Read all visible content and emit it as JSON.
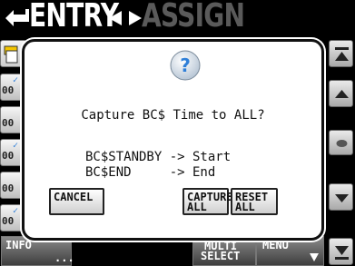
{
  "title": {
    "entry": "ENTRY",
    "assign": "ASSIGN"
  },
  "left_rows": [
    {
      "label": "00"
    },
    {
      "label": "00"
    },
    {
      "label": "00"
    },
    {
      "label": "00"
    },
    {
      "label": "00"
    }
  ],
  "dialog": {
    "question": "Capture BC$ Time to ALL?",
    "mappings": [
      "BC$STANDBY -> Start",
      "BC$END     -> End"
    ],
    "buttons": {
      "cancel": "CANCEL",
      "capture_all_line1": "CAPTURE",
      "capture_all_line2": "ALL",
      "reset_all_line1": "RESET",
      "reset_all_line2": "ALL"
    }
  },
  "bottom_bar": {
    "info": "INFO",
    "info_more": "...",
    "multi_select_line1": "MULTI",
    "multi_select_line2": "SELECT",
    "menu": "MENU"
  },
  "colors": {
    "accent_blue": "#2f7fd8",
    "title_dim": "#5a5a5a"
  }
}
